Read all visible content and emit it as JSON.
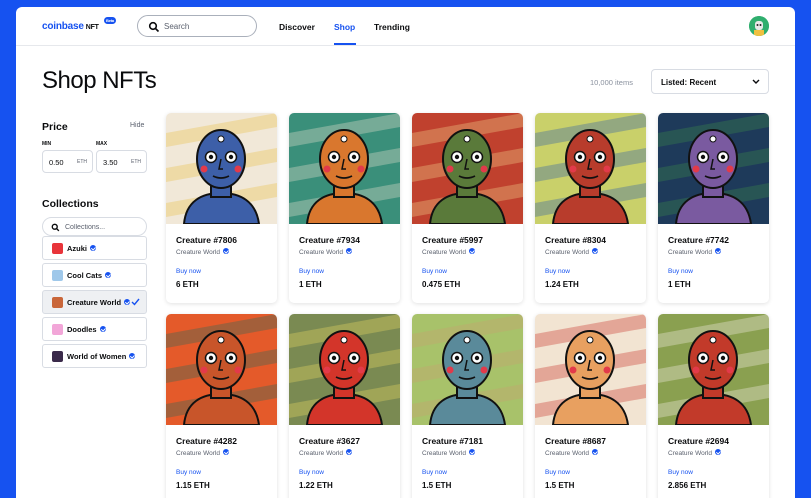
{
  "header": {
    "logo_text": "coinbase",
    "logo_suffix": "NFT",
    "logo_badge": "Beta",
    "search_placeholder": "Search",
    "nav": [
      {
        "label": "Discover",
        "active": false
      },
      {
        "label": "Shop",
        "active": true
      },
      {
        "label": "Trending",
        "active": false
      }
    ]
  },
  "page": {
    "title": "Shop NFTs",
    "item_count": "10,000 items",
    "sort_label": "Listed: Recent"
  },
  "filters": {
    "price_heading": "Price",
    "hide_label": "Hide",
    "min_label": "MIN",
    "max_label": "MAX",
    "min_value": "0.50",
    "max_value": "3.50",
    "unit": "ETH",
    "collections_heading": "Collections",
    "collections_placeholder": "Collections...",
    "collections": [
      {
        "name": "Azuki",
        "color": "#e8343a",
        "selected": false
      },
      {
        "name": "Cool Cats",
        "color": "#9fc8ea",
        "selected": false
      },
      {
        "name": "Creature World",
        "color": "#c9663a",
        "selected": true
      },
      {
        "name": "Doodles",
        "color": "#f2a6d8",
        "selected": false
      },
      {
        "name": "World of Women",
        "color": "#3a2a4a",
        "selected": false
      }
    ]
  },
  "colors": {
    "brand": "#1652f0",
    "text": "#0a0b0d",
    "muted": "#5b616e"
  },
  "cards": [
    {
      "name": "Creature #7806",
      "collection": "Creature World",
      "cta": "Buy now",
      "price": "6 ETH",
      "bg": "#f1e8d8",
      "skin": "#3d5fa8",
      "accent": "#e8c14a"
    },
    {
      "name": "Creature #7934",
      "collection": "Creature World",
      "cta": "Buy now",
      "price": "1 ETH",
      "bg": "#3a8f7a",
      "skin": "#d9772e",
      "accent": "#e8e0cf"
    },
    {
      "name": "Creature #5997",
      "collection": "Creature World",
      "cta": "Buy now",
      "price": "0.475 ETH",
      "bg": "#c0412e",
      "skin": "#5a7a3a",
      "accent": "#f0d28a"
    },
    {
      "name": "Creature #8304",
      "collection": "Creature World",
      "cta": "Buy now",
      "price": "1.24 ETH",
      "bg": "#c9d06a",
      "skin": "#b83c2c",
      "accent": "#2f5fa8"
    },
    {
      "name": "Creature #7742",
      "collection": "Creature World",
      "cta": "Buy now",
      "price": "1 ETH",
      "bg": "#1e3a5a",
      "skin": "#7a5aa0",
      "accent": "#3c8a4a"
    },
    {
      "name": "Creature #4282",
      "collection": "Creature World",
      "cta": "Buy now",
      "price": "1.15 ETH",
      "bg": "#e45a2a",
      "skin": "#c8552a",
      "accent": "#2a6a5a"
    },
    {
      "name": "Creature #3627",
      "collection": "Creature World",
      "cta": "Buy now",
      "price": "1.22 ETH",
      "bg": "#7a8a52",
      "skin": "#d3352a",
      "accent": "#e8d860"
    },
    {
      "name": "Creature #7181",
      "collection": "Creature World",
      "cta": "Buy now",
      "price": "1.5 ETH",
      "bg": "#a8c26a",
      "skin": "#5a8a9a",
      "accent": "#c8a070"
    },
    {
      "name": "Creature #8687",
      "collection": "Creature World",
      "cta": "Buy now",
      "price": "1.5 ETH",
      "bg": "#f2e4d2",
      "skin": "#e8a060",
      "accent": "#c8342a"
    },
    {
      "name": "Creature #2694",
      "collection": "Creature World",
      "cta": "Buy now",
      "price": "2.856 ETH",
      "bg": "#8aa050",
      "skin": "#c23a2a",
      "accent": "#f4efe6"
    }
  ]
}
